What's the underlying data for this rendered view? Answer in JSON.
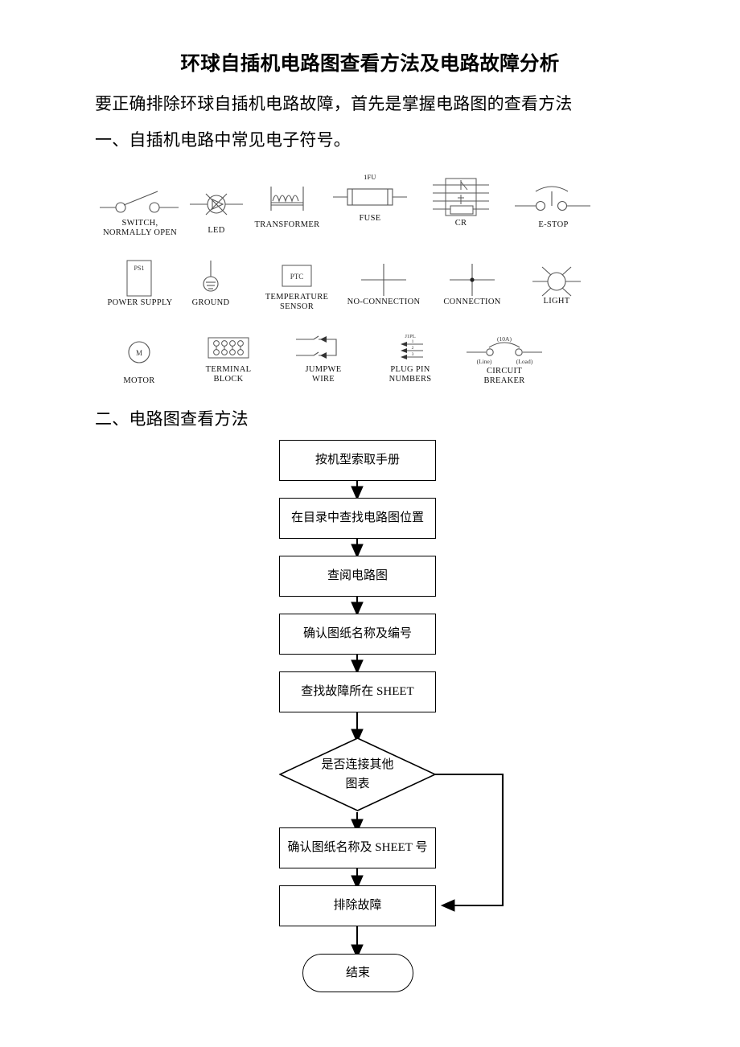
{
  "document": {
    "title": "环球自插机电路图查看方法及电路故障分析",
    "intro": "要正确排除环球自插机电路故障，首先是掌握电路图的查看方法",
    "section_1": "一、自插机电路中常见电子符号。",
    "section_2": "二、电路图查看方法"
  },
  "symbols": {
    "row1": [
      {
        "name": "switch-normally-open",
        "caption": "SWITCH,\nNORMALLY OPEN",
        "tag": ""
      },
      {
        "name": "led",
        "caption": "LED",
        "tag": ""
      },
      {
        "name": "transformer",
        "caption": "TRANSFORMER",
        "tag": ""
      },
      {
        "name": "fuse",
        "caption": "FUSE",
        "tag": "1FU"
      },
      {
        "name": "control-relay",
        "caption": "CR",
        "tag": ""
      },
      {
        "name": "e-stop",
        "caption": "E-STOP",
        "tag": ""
      }
    ],
    "row2": [
      {
        "name": "power-supply",
        "caption": "POWER SUPPLY",
        "tag": "PS1"
      },
      {
        "name": "ground",
        "caption": "GROUND",
        "tag": ""
      },
      {
        "name": "temperature-sensor",
        "caption": "TEMPERATURE\nSENSOR",
        "tag": "PTC"
      },
      {
        "name": "no-connection",
        "caption": "NO-CONNECTION",
        "tag": ""
      },
      {
        "name": "connection",
        "caption": "CONNECTION",
        "tag": ""
      },
      {
        "name": "light",
        "caption": "LIGHT",
        "tag": ""
      }
    ],
    "row3": [
      {
        "name": "motor",
        "caption": "MOTOR",
        "tag": "M"
      },
      {
        "name": "terminal-block",
        "caption": "TERMINAL\nBLOCK",
        "tag": ""
      },
      {
        "name": "jumper-wire",
        "caption": "JUMPWE\nWIRE",
        "tag": ""
      },
      {
        "name": "plug-pin-numbers",
        "caption": "PLUG PIN\nNUMBERS",
        "tag": "J1PL",
        "pins": [
          "1",
          "2",
          "3"
        ]
      },
      {
        "name": "circuit-breaker",
        "caption": "CIRCUIT\nBREAKER",
        "tag": "(10A)",
        "left_label": "(Line)",
        "right_label": "(Load)"
      }
    ]
  },
  "flowchart": {
    "nodes": [
      {
        "id": "n1",
        "shape": "box",
        "label": "按机型索取手册"
      },
      {
        "id": "n2",
        "shape": "box",
        "label": "在目录中查找电路图位置"
      },
      {
        "id": "n3",
        "shape": "box",
        "label": "查阅电路图"
      },
      {
        "id": "n4",
        "shape": "box",
        "label": "确认图纸名称及编号"
      },
      {
        "id": "n5",
        "shape": "box",
        "label": "查找故障所在 SHEET"
      },
      {
        "id": "n6",
        "shape": "diamond",
        "label": "是否连接其他\n图表"
      },
      {
        "id": "n7",
        "shape": "box",
        "label": "确认图纸名称及 SHEET 号"
      },
      {
        "id": "n8",
        "shape": "box",
        "label": "排除故障"
      },
      {
        "id": "n9",
        "shape": "terminator",
        "label": "结束"
      }
    ]
  },
  "colors": {
    "ink": "#000000",
    "page": "#ffffff",
    "symbol_line": "#555555"
  }
}
